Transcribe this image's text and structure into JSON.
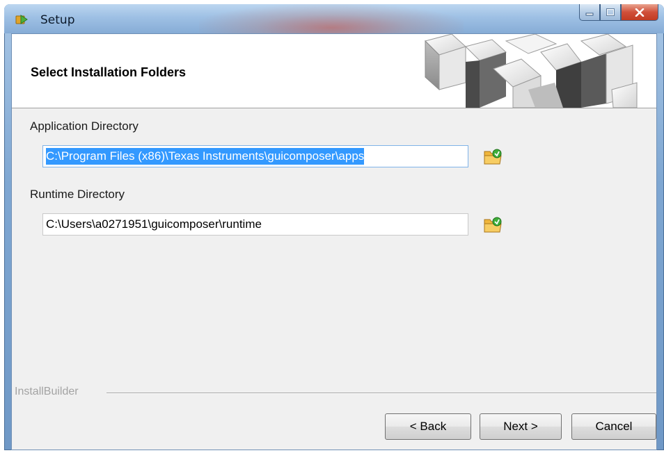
{
  "window": {
    "title": "Setup"
  },
  "header": {
    "title": "Select Installation Folders"
  },
  "application_directory": {
    "label": "Application Directory",
    "value": "C:\\Program Files (x86)\\Texas Instruments\\guicomposer\\apps",
    "selected": true
  },
  "runtime_directory": {
    "label": "Runtime Directory",
    "value": "C:\\Users\\a0271951\\guicomposer\\runtime"
  },
  "footer": {
    "brand": "InstallBuilder",
    "back_label": "< Back",
    "next_label": "Next >",
    "cancel_label": "Cancel"
  },
  "icons": {
    "app": "setup-app-icon",
    "browse": "folder-browse-icon",
    "minimize": "minimize-icon",
    "maximize": "maximize-icon",
    "close": "close-icon",
    "header_graphic": "cube-graphic"
  },
  "colors": {
    "selection": "#3399ff",
    "close_button": "#c9452d",
    "client_background": "#f0f0f0"
  }
}
